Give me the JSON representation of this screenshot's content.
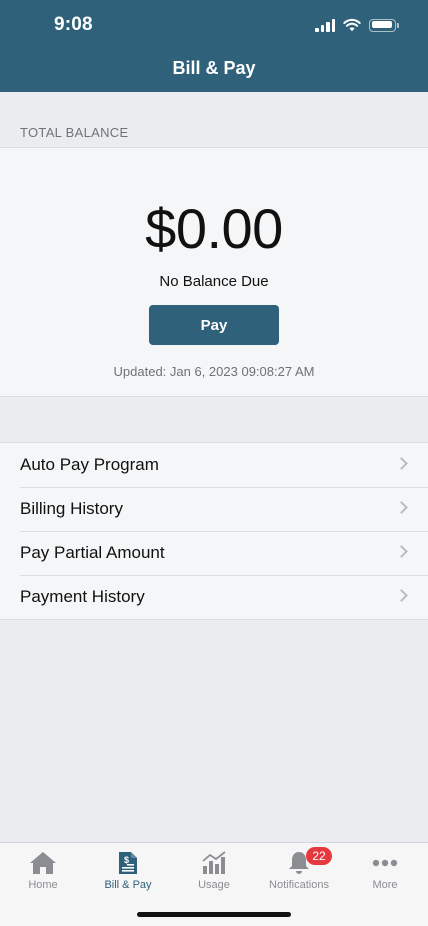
{
  "status_bar": {
    "time": "9:08"
  },
  "header": {
    "title": "Bill & Pay"
  },
  "balance": {
    "section_label": "TOTAL BALANCE",
    "amount": "$0.00",
    "status": "No Balance Due",
    "pay_label": "Pay",
    "updated": "Updated: Jan 6, 2023 09:08:27 AM"
  },
  "menu": {
    "items": [
      {
        "label": "Auto Pay Program"
      },
      {
        "label": "Billing History"
      },
      {
        "label": "Pay Partial Amount"
      },
      {
        "label": "Payment History"
      }
    ]
  },
  "tabs": [
    {
      "label": "Home",
      "icon": "home-icon"
    },
    {
      "label": "Bill & Pay",
      "icon": "bill-icon",
      "active": true
    },
    {
      "label": "Usage",
      "icon": "chart-icon"
    },
    {
      "label": "Notifications",
      "icon": "bell-icon",
      "badge": "22"
    },
    {
      "label": "More",
      "icon": "more-icon"
    }
  ],
  "colors": {
    "brand": "#2f617b",
    "badge": "#e5393f",
    "background": "#ebecf0"
  }
}
